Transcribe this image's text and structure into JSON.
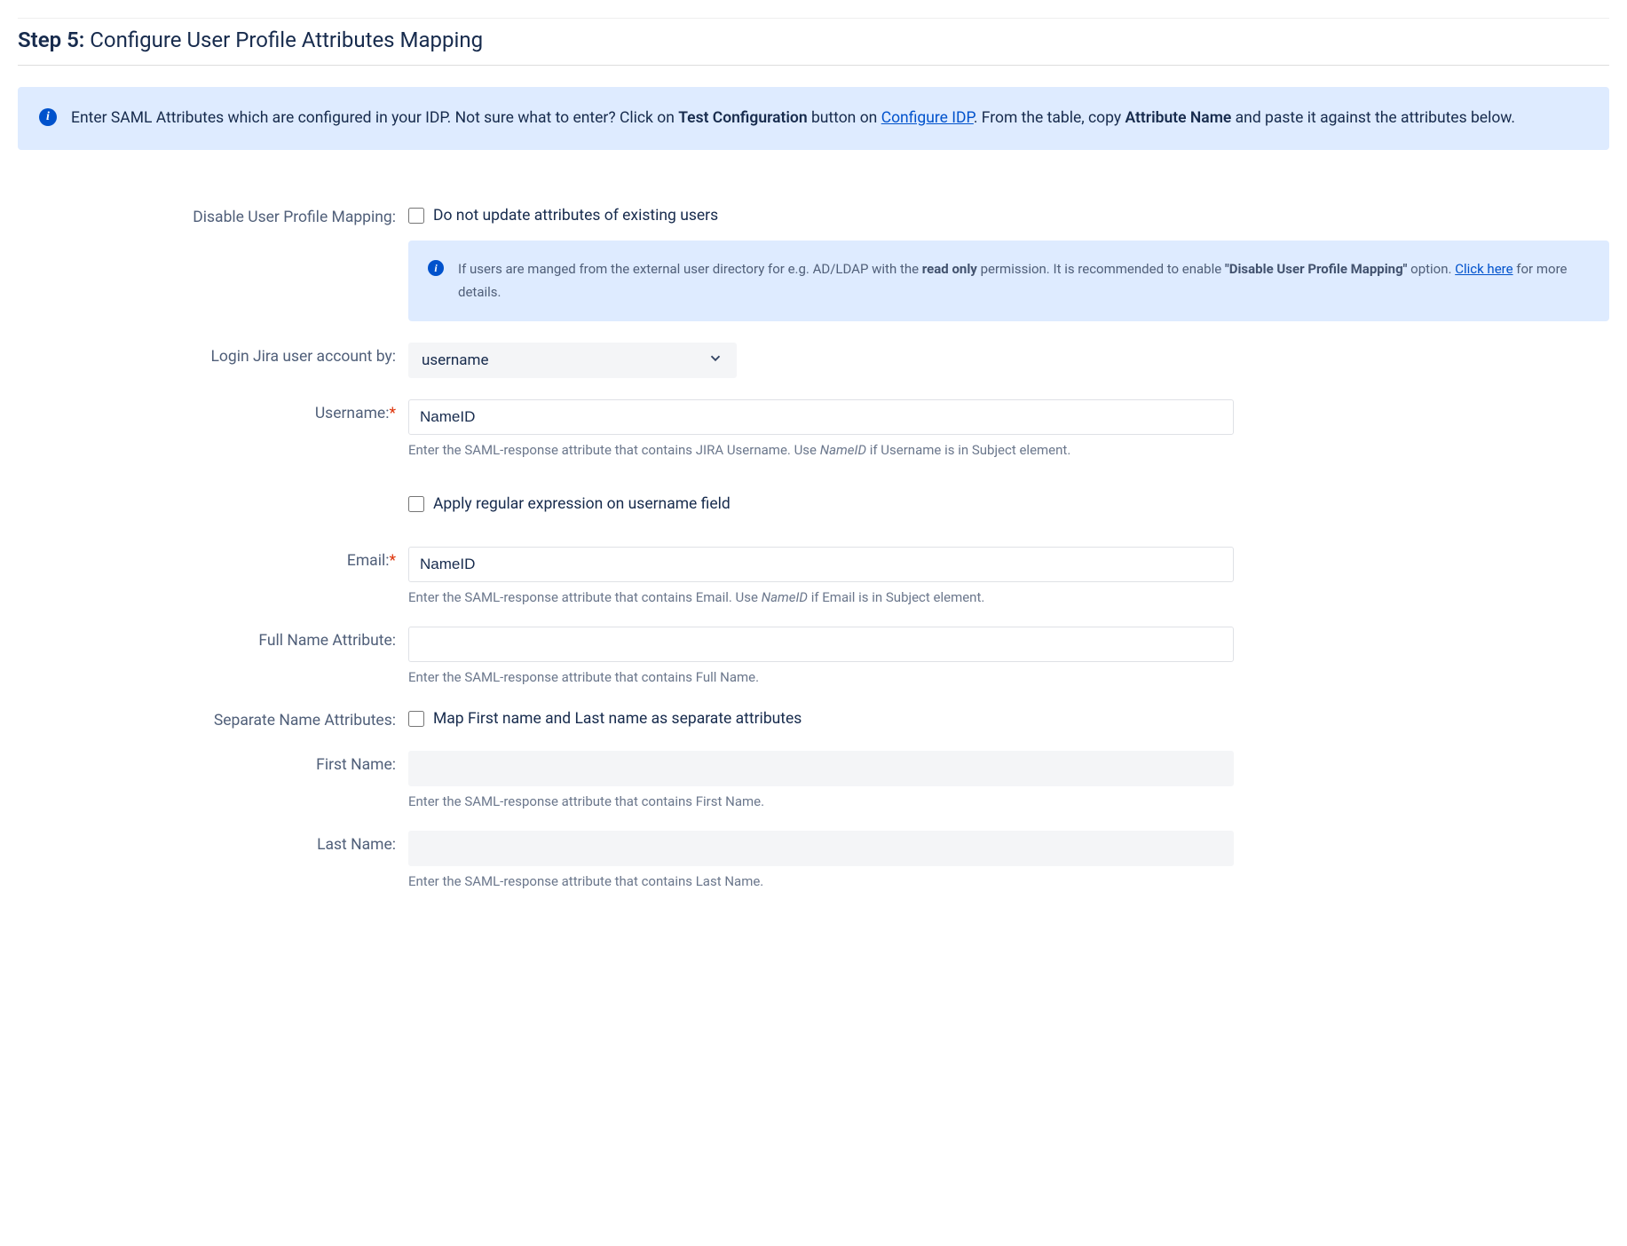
{
  "header": {
    "step_label": "Step 5:",
    "title": "Configure User Profile Attributes Mapping"
  },
  "info": {
    "part1": "Enter SAML Attributes which are configured in your IDP. Not sure what to enter? Click on ",
    "test_config": "Test Configuration",
    "part2": " button on ",
    "link": "Configure IDP",
    "part3": ". From the table, copy ",
    "attr_name": "Attribute Name",
    "part4": " and paste it against the attributes below."
  },
  "fields": {
    "disable_mapping": {
      "label": "Disable User Profile Mapping:",
      "checkbox_label": "Do not update attributes of existing users"
    },
    "inner_info": {
      "part1": "If users are manged from the external user directory for e.g. AD/LDAP with the ",
      "readonly": "read only",
      "part2": " permission. It is recommended to enable ",
      "disable_map": "\"Disable User Profile Mapping\"",
      "part3": " option. ",
      "link": "Click here",
      "part4": " for more details."
    },
    "login_by": {
      "label": "Login Jira user account by:",
      "value": "username"
    },
    "username": {
      "label": "Username:",
      "value": "NameID",
      "hint1": "Enter the SAML-response attribute that contains JIRA Username. Use ",
      "hint_ital": "NameID",
      "hint2": " if Username is in Subject element."
    },
    "regex": {
      "checkbox_label": "Apply regular expression on username field"
    },
    "email": {
      "label": "Email:",
      "value": "NameID",
      "hint1": "Enter the SAML-response attribute that contains Email. Use ",
      "hint_ital": "NameID",
      "hint2": " if Email is in Subject element."
    },
    "fullname": {
      "label": "Full Name Attribute:",
      "value": "",
      "hint": "Enter the SAML-response attribute that contains Full Name."
    },
    "separate": {
      "label": "Separate Name Attributes:",
      "checkbox_label": "Map First name and Last name as separate attributes"
    },
    "firstname": {
      "label": "First Name:",
      "value": "",
      "hint": "Enter the SAML-response attribute that contains First Name."
    },
    "lastname": {
      "label": "Last Name:",
      "value": "",
      "hint": "Enter the SAML-response attribute that contains Last Name."
    }
  }
}
